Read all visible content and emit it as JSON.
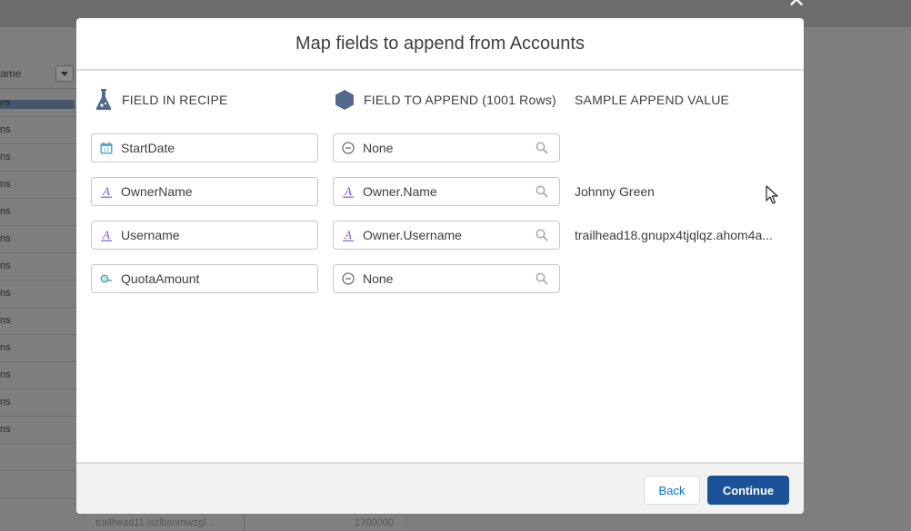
{
  "background": {
    "column_header": "ame",
    "row_suffix": "ns",
    "bottom_row_text": "trailhead11.ixzlbsnmwzgl...",
    "bottom_row_num": "1700000"
  },
  "modal": {
    "title": "Map fields to append from Accounts",
    "columns": {
      "recipe": "FIELD IN RECIPE",
      "append": "FIELD TO APPEND (1001 Rows)",
      "sample": "SAMPLE APPEND VALUE"
    },
    "rows": [
      {
        "recipe_field": "StartDate",
        "recipe_icon": "calendar-icon",
        "append_field": "None",
        "append_icon": "none-icon",
        "sample": ""
      },
      {
        "recipe_field": "OwnerName",
        "recipe_icon": "text-icon",
        "append_field": "Owner.Name",
        "append_icon": "text-icon",
        "sample": "Johnny Green"
      },
      {
        "recipe_field": "Username",
        "recipe_icon": "text-icon",
        "append_field": "Owner.Username",
        "append_icon": "text-icon",
        "sample": "trailhead18.gnupx4tjqlqz.ahom4a..."
      },
      {
        "recipe_field": "QuotaAmount",
        "recipe_icon": "number-icon",
        "append_field": "None",
        "append_icon": "none-icon",
        "sample": ""
      }
    ],
    "buttons": {
      "back": "Back",
      "continue": "Continue"
    }
  },
  "colors": {
    "brand": "#1b5297",
    "link": "#0070d2",
    "text_icon": "#7f5ad6",
    "date_icon": "#4ba6e4",
    "number_icon": "#3aa8a0"
  }
}
